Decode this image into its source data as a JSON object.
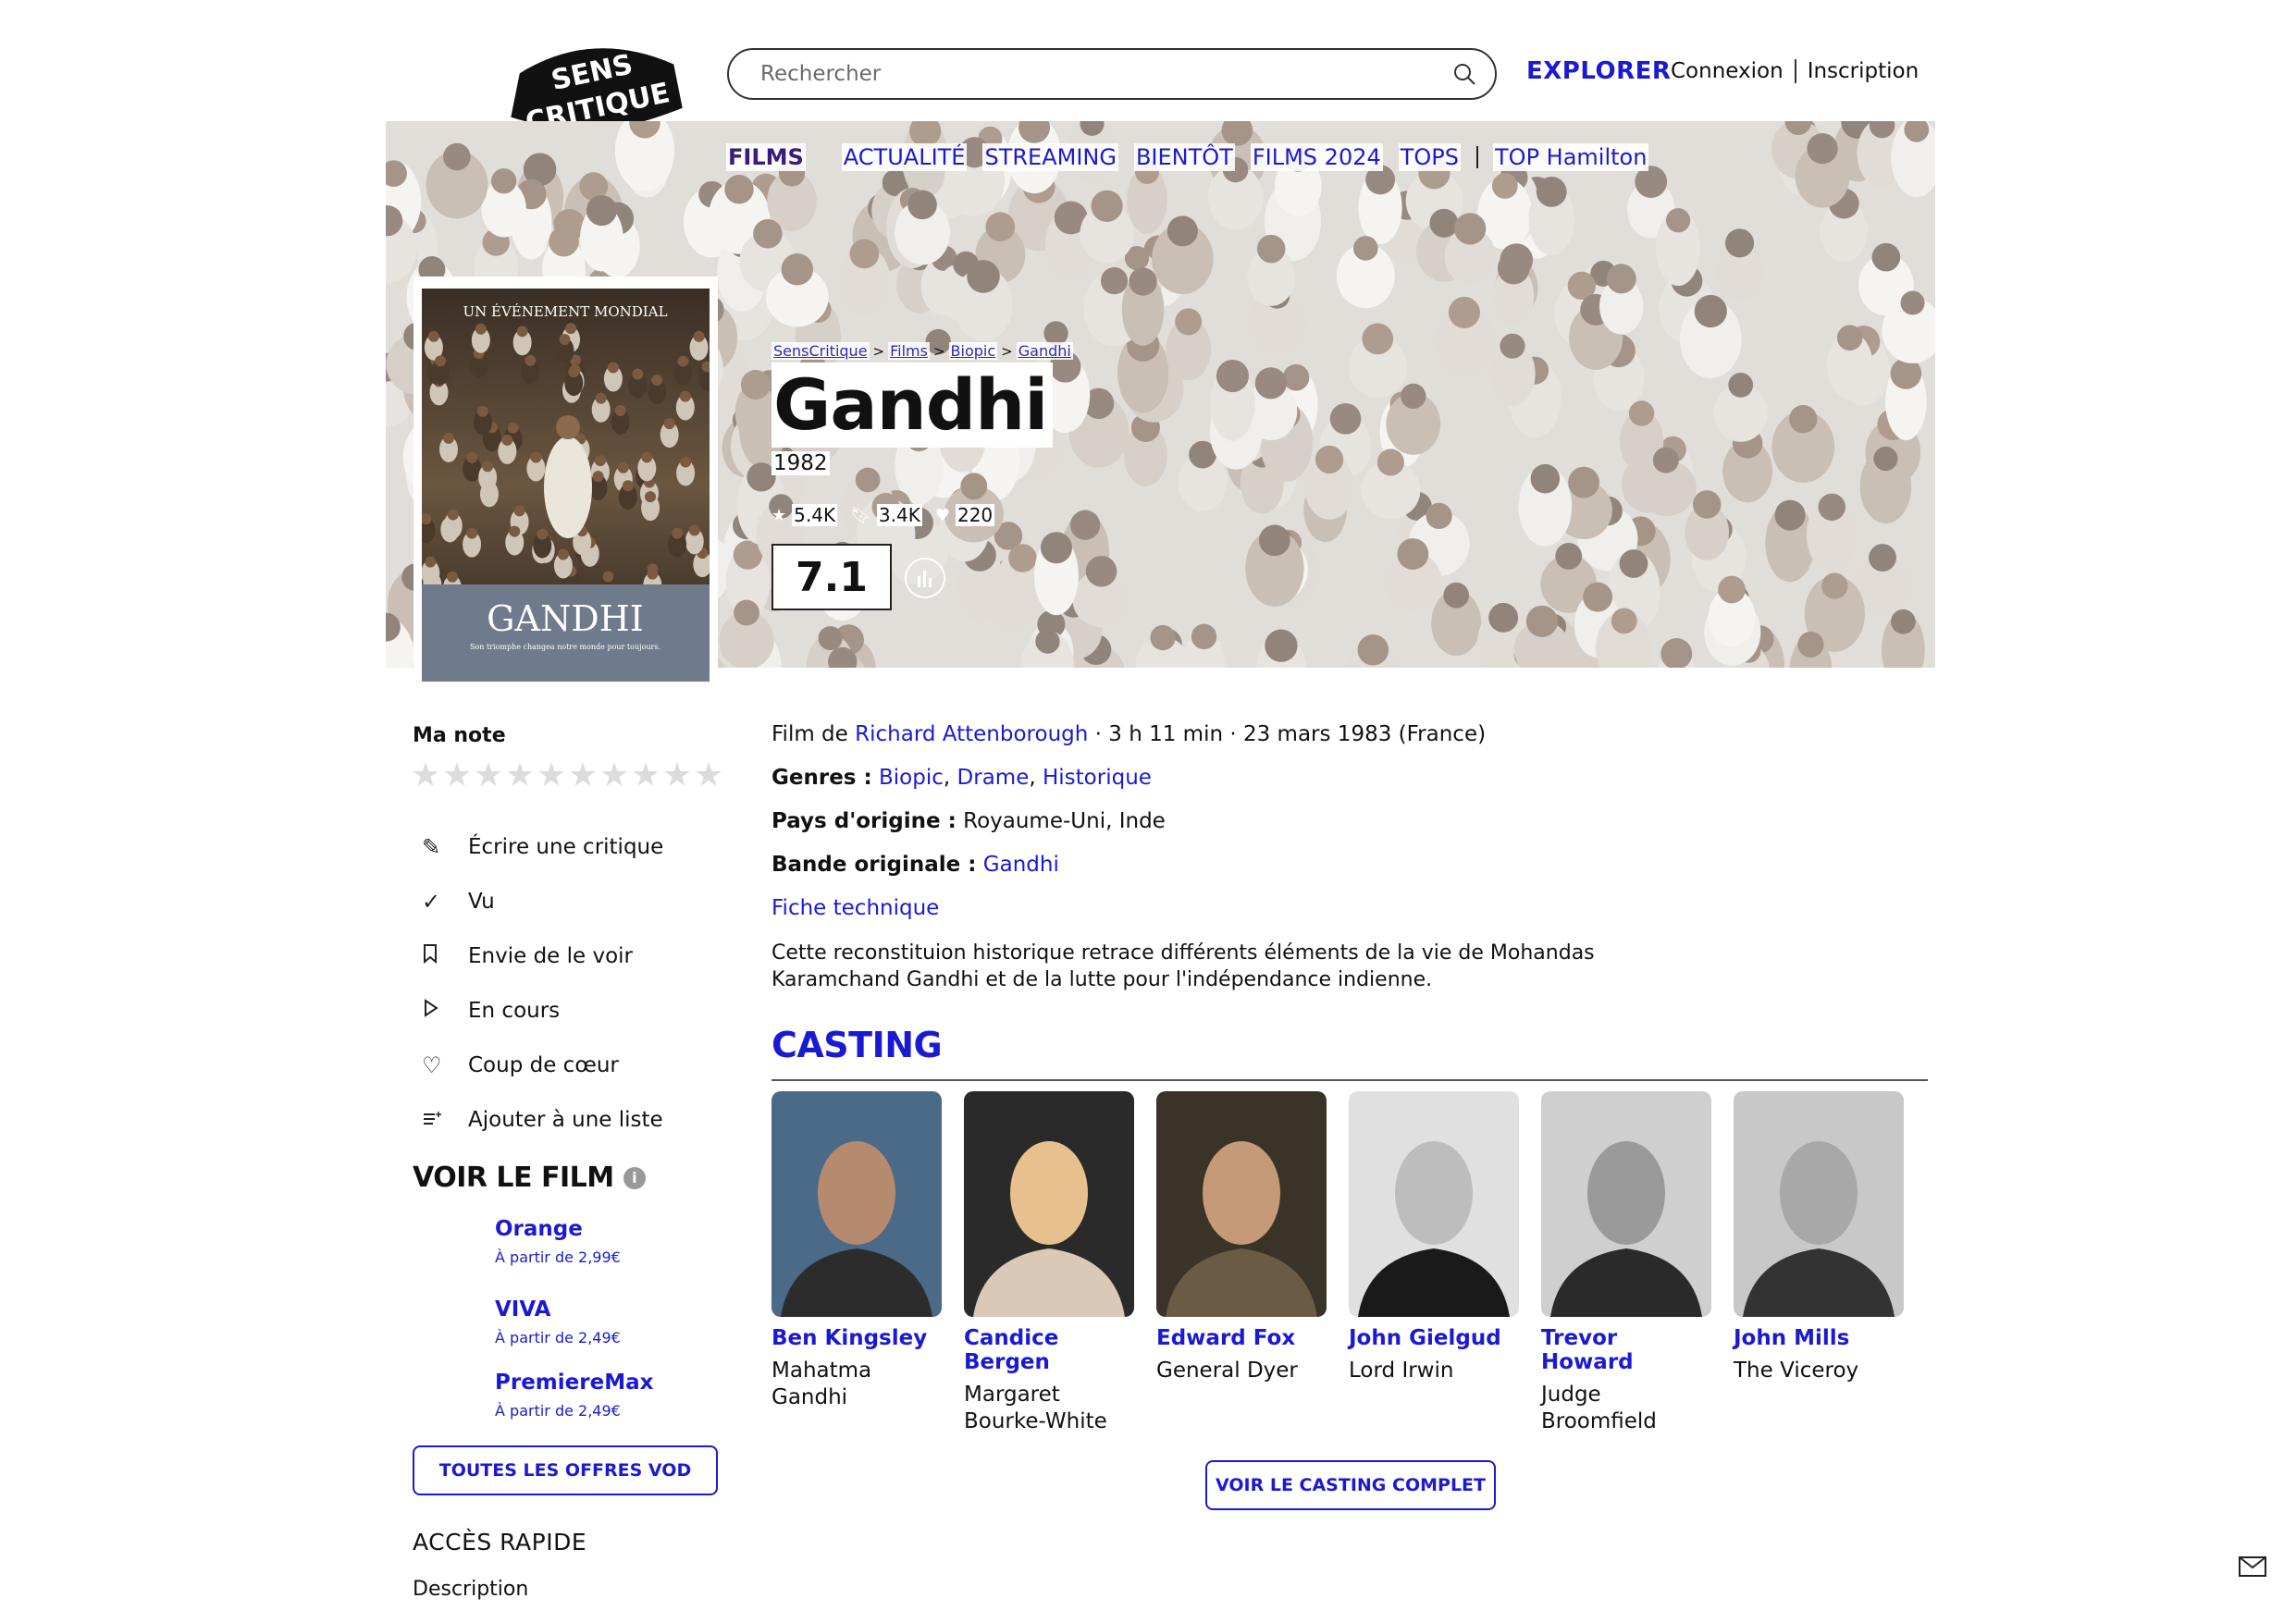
{
  "header": {
    "logo_text": "SENS CRITIQUE",
    "search_placeholder": "Rechercher",
    "explore_label": "EXPLORER",
    "login_label": "Connexion",
    "signup_label": "Inscription"
  },
  "nav": {
    "items": [
      "FILMS",
      "ACTUALITÉ",
      "STREAMING",
      "BIENTÔT",
      "FILMS 2024",
      "TOPS",
      "TOP Hamilton"
    ]
  },
  "breadcrumb": [
    "SensCritique",
    "Films",
    "Biopic",
    "Gandhi"
  ],
  "movie": {
    "title": "Gandhi",
    "year": "1982",
    "stats": {
      "ratings": "5.4K",
      "wishlist": "3.4K",
      "likes": "220"
    },
    "rating": "7.1",
    "poster": {
      "top_text": "UN ÉVÉNEMENT MONDIAL",
      "title": "GANDHI",
      "tagline": "Son triomphe changea notre monde pour toujours."
    },
    "director_prefix": "Film de",
    "director": "Richard Attenborough",
    "details": "· 3 h 11 min · 23 mars 1983 (France)",
    "genres_label": "Genres :",
    "genres": [
      "Biopic",
      "Drame",
      "Historique"
    ],
    "country_label": "Pays d'origine :",
    "country": "Royaume-Uni, Inde",
    "soundtrack_label": "Bande originale :",
    "soundtrack": "Gandhi",
    "tech_sheet": "Fiche technique",
    "synopsis": "Cette reconstituion historique retrace différents éléments de la vie de Mohandas Karamchand Gandhi et de la lutte pour l'indépendance indienne."
  },
  "sidebar": {
    "my_rating_label": "Ma note",
    "star_count": 10,
    "actions": [
      {
        "icon": "pencil-icon",
        "label": "Écrire une critique"
      },
      {
        "icon": "check-icon",
        "label": "Vu"
      },
      {
        "icon": "bookmark-icon",
        "label": "Envie de le voir"
      },
      {
        "icon": "play-icon",
        "label": "En cours"
      },
      {
        "icon": "heart-icon",
        "label": "Coup de cœur"
      },
      {
        "icon": "add-list-icon",
        "label": "Ajouter à une liste"
      }
    ],
    "watch_title": "VOIR LE FILM",
    "vod": [
      {
        "name": "Orange",
        "price": "À partir de 2,99€"
      },
      {
        "name": "VIVA",
        "price": "À partir de 2,49€"
      },
      {
        "name": "PremiereMax",
        "price": "À partir de 2,49€"
      }
    ],
    "all_vod_label": "TOUTES LES OFFRES VOD",
    "quick_access_label": "ACCÈS RAPIDE",
    "description_label": "Description"
  },
  "casting": {
    "title": "CASTING",
    "actors": [
      {
        "name": "Ben Kingsley",
        "role": "Mahatma Gandhi"
      },
      {
        "name": "Candice Bergen",
        "role": "Margaret Bourke-White"
      },
      {
        "name": "Edward Fox",
        "role": "General Dyer"
      },
      {
        "name": "John Gielgud",
        "role": "Lord Irwin"
      },
      {
        "name": "Trevor Howard",
        "role": "Judge Broomfield"
      },
      {
        "name": "John Mills",
        "role": "The Viceroy"
      }
    ],
    "full_cast_label": "VOIR LE CASTING COMPLET"
  },
  "colors": {
    "accent": "#1a1ad4",
    "active_nav": "#3a1a7a"
  }
}
